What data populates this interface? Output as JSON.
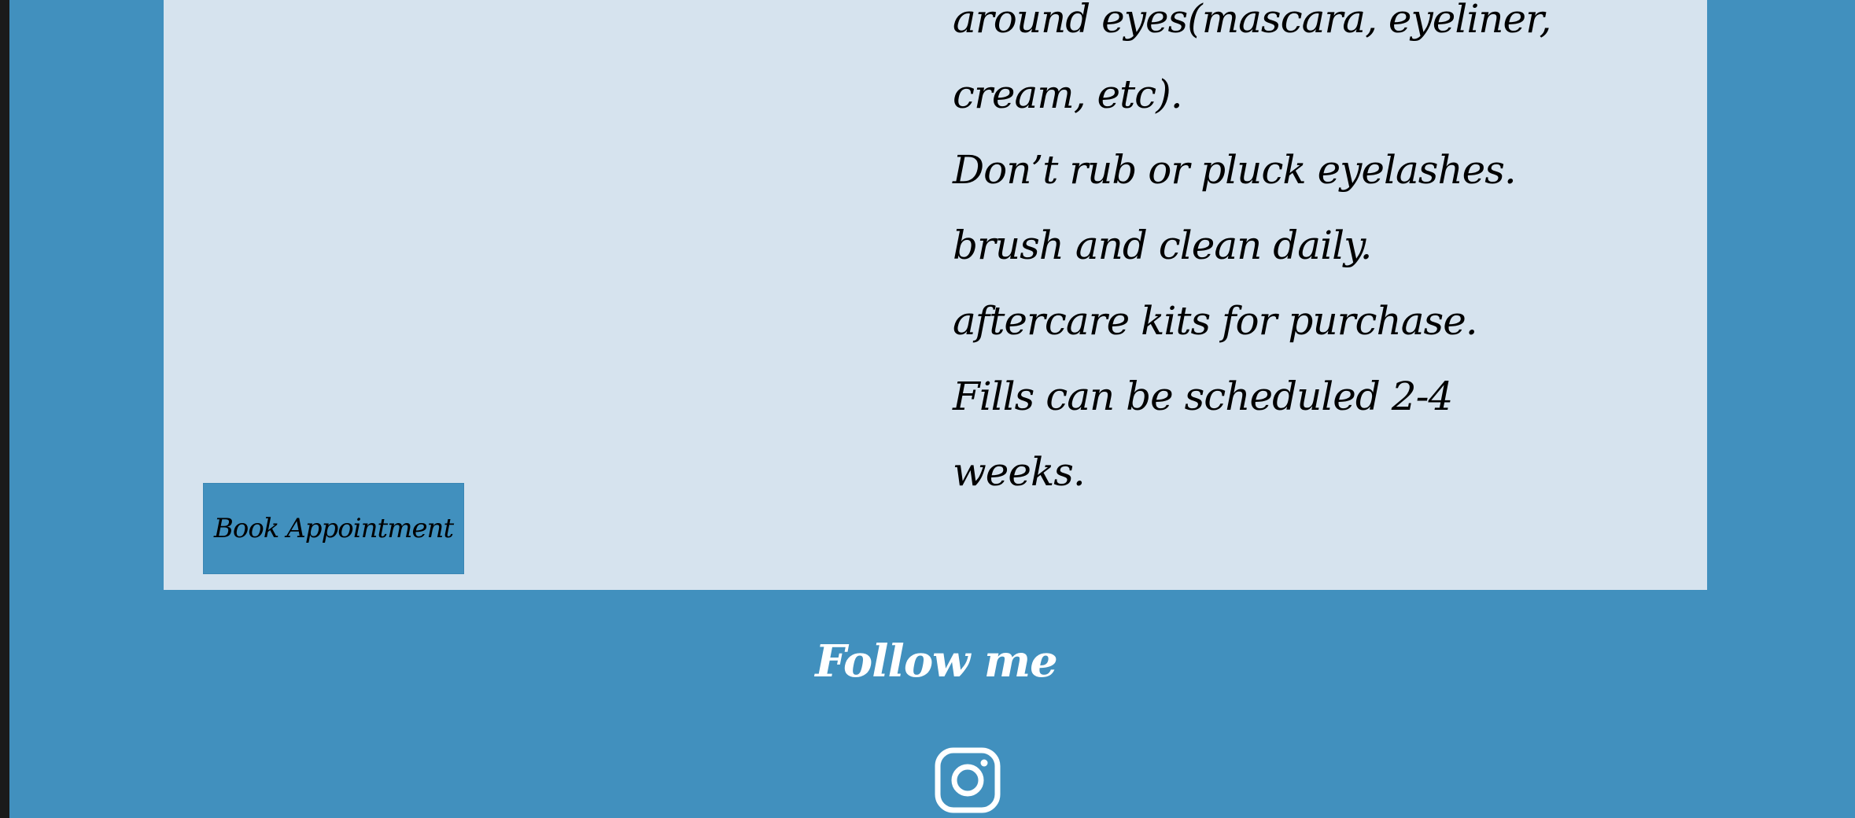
{
  "content": {
    "lines": [
      "around eyes(mascara, eyeliner,",
      "cream, etc).",
      "Don’t rub or pluck eyelashes.",
      "brush and clean daily.",
      "aftercare kits for purchase.",
      "Fills can be scheduled 2-4",
      "weeks."
    ],
    "book_button_label": "Book Appointment"
  },
  "footer": {
    "title": "Follow me",
    "social_icon": "instagram-icon"
  },
  "colors": {
    "page_background": "#4190be",
    "card_background": "#d6e3ee",
    "button_background": "#4190be",
    "footer_text": "#ffffff"
  }
}
